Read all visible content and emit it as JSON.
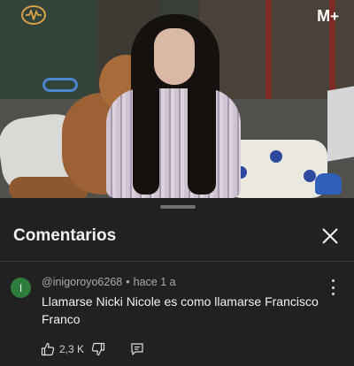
{
  "video": {
    "brand_label": "M",
    "brand_plus": "+",
    "channel_logo": "waveform-icon"
  },
  "comments_sheet": {
    "title": "Comentarios",
    "close_icon": "close-icon"
  },
  "comment": {
    "avatar_letter": "I",
    "avatar_color": "#2e7d3c",
    "author": "@inigoroyo6268",
    "separator": "•",
    "time": "hace 1 a",
    "text": "Llamarse Nicki Nicole es como llamarse Francisco Franco",
    "like_count": "2,3 K"
  }
}
